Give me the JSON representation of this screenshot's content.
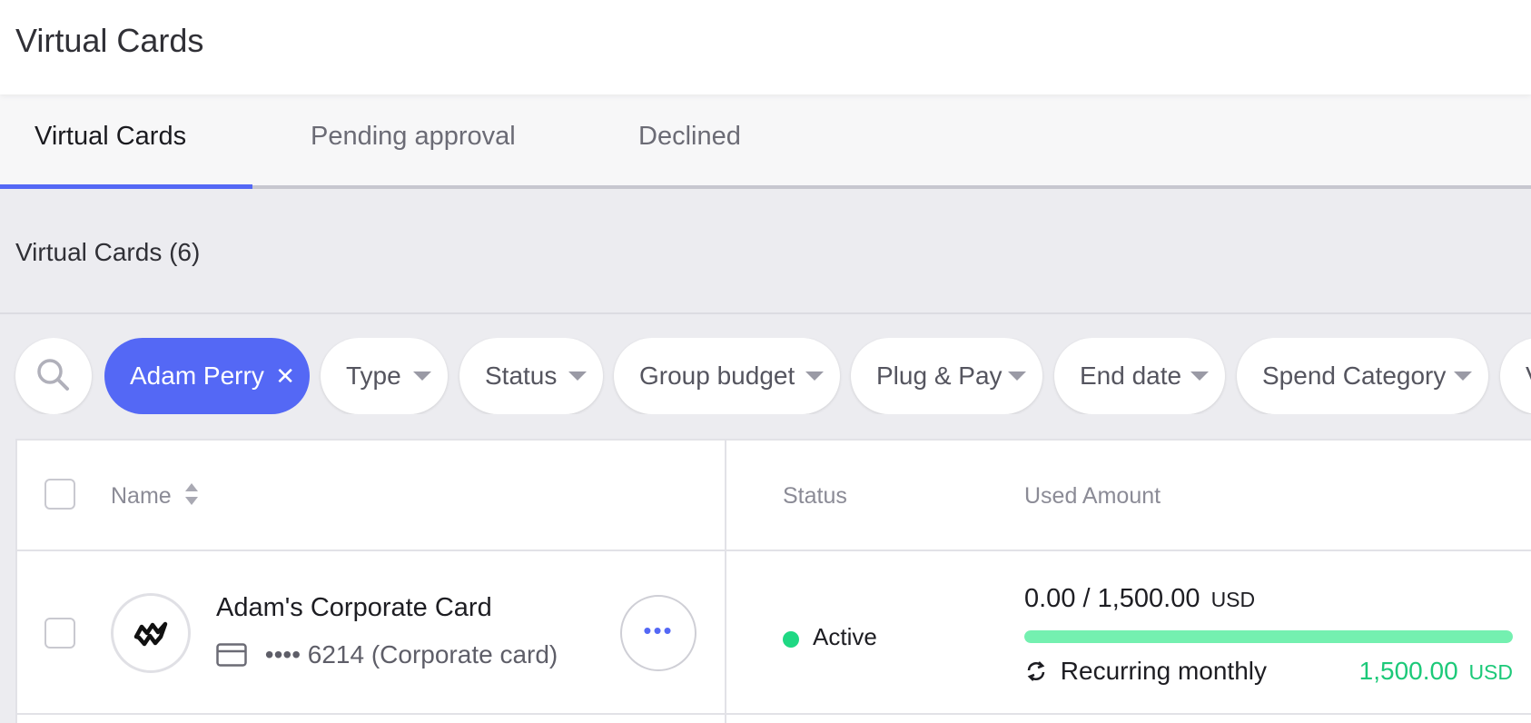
{
  "header": {
    "title": "Virtual Cards"
  },
  "tabs": [
    {
      "label": "Virtual Cards",
      "active": true
    },
    {
      "label": "Pending approval",
      "active": false
    },
    {
      "label": "Declined",
      "active": false
    }
  ],
  "section": {
    "title": "Virtual Cards (6)"
  },
  "filters": {
    "search_icon": "search-icon",
    "active_filter": {
      "label": "Adam Perry",
      "remove_icon": "close-icon"
    },
    "chips": [
      {
        "label": "Type"
      },
      {
        "label": "Status"
      },
      {
        "label": "Group budget"
      },
      {
        "label": "Plug & Pay"
      },
      {
        "label": "End date"
      },
      {
        "label": "Spend Category"
      },
      {
        "label": "V"
      }
    ]
  },
  "table": {
    "columns": {
      "name": "Name",
      "status": "Status",
      "used_amount": "Used Amount"
    },
    "rows": [
      {
        "name": "Adam's Corporate Card",
        "card_masked": "•••• 6214",
        "card_type": "(Corporate card)",
        "more_label": "•••",
        "status": "Active",
        "status_color": "#1fd883",
        "used": "0.00 / 1,500.00",
        "used_currency": "USD",
        "used_fraction": 0,
        "recurrence": "Recurring monthly",
        "remaining": "1,500.00",
        "remaining_currency": "USD"
      }
    ]
  },
  "colors": {
    "accent": "#5468f5",
    "success": "#1cc979",
    "progress_fill": "#74f0b0"
  }
}
